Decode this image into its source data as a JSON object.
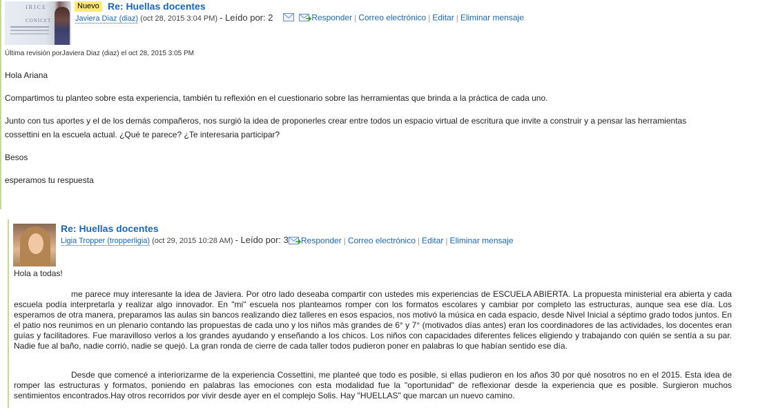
{
  "post1": {
    "badge": "Nuevo",
    "subject": "Re: Huellas docentes",
    "author": "Javiera Diaz (diaz)",
    "date": "(oct 28, 2015 3:04 PM)",
    "read": "- Leído por: 2",
    "actions": {
      "reply": "Responder",
      "email": "Correo electrónico",
      "edit": "Editar",
      "delete": "Eliminar mensaje"
    },
    "revision": "Última revisión porJaviera Diaz (diaz) el oct 28, 2015 3:05 PM",
    "avatar_text": [
      "IRICE",
      "CONICET"
    ],
    "paragraphs": [
      "Hola Ariana",
      "Compartimos tu planteo sobre esta experiencia, también tu reflexión en el cuestionario sobre las herramientas que brinda a la práctica de cada uno.",
      "Junto con tus aportes y el de los demás compañeros, nos surgió la idea de proponerles crear entre todos un espacio virtual de escritura que invite a construir y a pensar las herramientas cossettini en la escuela actual. ¿Qué te parece? ¿Te interesaria participar?",
      "Besos",
      "esperamos tu respuesta"
    ]
  },
  "post2": {
    "subject": "Re: Huellas docentes",
    "author": "Ligia Tropper (tropperligia)",
    "date": "(oct 29, 2015 10:28 AM)",
    "read": "- Leído por: 3",
    "actions": {
      "reply": "Responder",
      "email": "Correo electrónico",
      "edit": "Editar",
      "delete": "Eliminar mensaje"
    },
    "greeting": "Hola a todas!",
    "paragraphs": [
      "me parece muy interesante la idea de Javiera. Por otro lado deseaba compartir con ustedes mis experiencias de ESCUELA ABIERTA. La propuesta ministerial era abierta y cada escuela podía interpretarla y realizar algo innovador. En \"mi\" escuela nos planteamos romper con los formatos escolares y cambiar por completo las estructuras, aunque sea ese día. Los esperamos de otra manera, preparamos las aulas sin bancos  realizando diez talleres en esos espacios, nos motivó la música en cada espacio, desde Nivel Inicial a séptimo grado todos juntos. En el patio nos reunimos en un plenario contando las propuestas de cada uno y los niños más grandes de 6° y 7° (motivados días antes) eran los coordinadores de las actividades, los docentes eran guías y facilitadores. Fue maravilloso verlos a los grandes ayudando y enseñando a los chicos. Los niños con capacidades diferentes felices eligiendo y trabajando con quién se sentía a su par. Nadie fue al baño, nadie corrió, nadie se quejó. La gran ronda de cierre de cada taller todos pudieron poner en palabras lo que habían sentido ese día.",
      "Desde que comencé a interiorizarme de la experiencia Cossettini, me planteé que todo es posible, si ellas pudieron en los años 30 por qué nosotros no en el 2015. Esta idea de romper las estructuras y formatos, poniendo en palabras las emociones con esta modalidad fue la \"oportunidad\" de reflexionar desde la experiencia que es posible. Surgieron muchos sentimientos encontrados.Hay otros recorridos por vivir desde ayer en el complejo Solis. Hay \"HUELLAS\" que  marcan un nuevo camino."
    ]
  },
  "colors": {
    "link": "#1a66b3",
    "badge_bg": "#ffe87a",
    "thread_bar": "#c5d98f"
  },
  "icons": [
    "envelope-icon",
    "reply-icon"
  ]
}
